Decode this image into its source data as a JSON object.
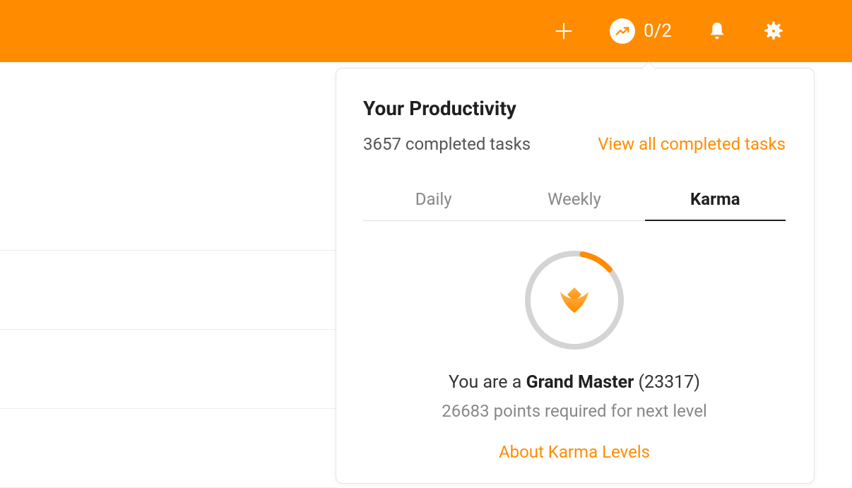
{
  "header": {
    "productivity_count": "0/2"
  },
  "dropdown": {
    "title": "Your Productivity",
    "completed_tasks_text": "3657 completed tasks",
    "view_all_label": "View all completed tasks",
    "tabs": [
      {
        "label": "Daily"
      },
      {
        "label": "Weekly"
      },
      {
        "label": "Karma"
      }
    ],
    "karma": {
      "level_prefix": "You are a ",
      "level_name": "Grand Master",
      "level_suffix": " (23317)",
      "points_text": "26683 points required for next level",
      "about_label": "About Karma Levels"
    }
  },
  "colors": {
    "accent": "#FF8C00"
  }
}
